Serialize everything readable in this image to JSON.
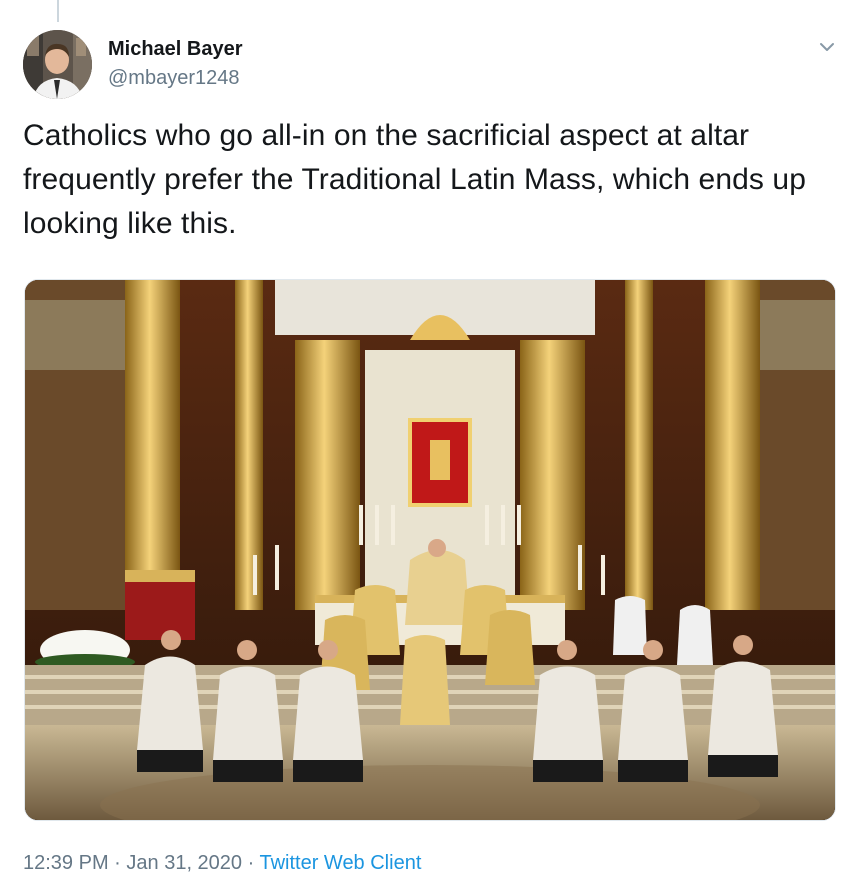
{
  "tweet": {
    "author_name": "Michael Bayer",
    "author_handle": "@mbayer1248",
    "text": "Catholics who go all-in on the sacrificial aspect at altar frequently prefer the Traditional Latin Mass, which ends up looking like this.",
    "time": "12:39 PM",
    "separator_1": " · ",
    "date": "Jan 31, 2020",
    "separator_2": " · ",
    "client": "Twitter Web Client"
  },
  "icons": {
    "more": "chevron-down-icon"
  },
  "colors": {
    "link": "#1b95e0",
    "secondary_text": "#657786",
    "primary_text": "#14171a"
  }
}
